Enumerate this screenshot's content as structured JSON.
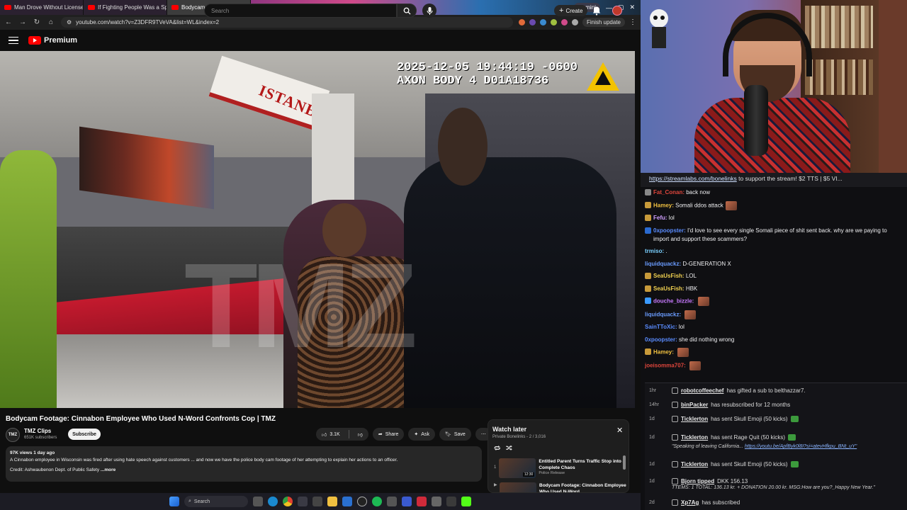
{
  "browser": {
    "tabs": [
      {
        "title": "Man Drove Without License Fo",
        "active": false
      },
      {
        "title": "If Fighting People Was a Sport",
        "active": false
      },
      {
        "title": "Bodycam Footage: Cinnab",
        "active": true
      }
    ],
    "gemini_label": "Gemini",
    "url": "youtube.com/watch?v=Z3DFR9TVeVA&list=WL&index=2",
    "finish_update": "Finish update"
  },
  "youtube": {
    "logo_text": "Premium",
    "search_placeholder": "Search",
    "create_label": "Create"
  },
  "video": {
    "timestamp_line1": "2025-12-05 19:44:19 -0600",
    "timestamp_line2": "AXON BODY 4 D01A18736",
    "sign_text": "ISTANBUL",
    "watermark": "TMZ",
    "title": "Bodycam Footage: Cinnabon Employee Who Used N-Word Confronts Cop | TMZ",
    "channel": {
      "name": "TMZ Clips",
      "subscribers": "651K subscribers",
      "avatar_text": "TMZ"
    },
    "subscribe_label": "Subscribe",
    "likes": "3.1K",
    "share_label": "Share",
    "ask_label": "Ask",
    "save_label": "Save",
    "description": {
      "meta": "97K views  1 day ago",
      "line1": "A Cinnabon employee in Wisconsin was fired after using hate speech against customers ... and now we have the police body cam footage of her attempting to explain her actions to an officer.",
      "credit": "Credit: Ashwaubenon Dept. of Public Safety",
      "more": "...more"
    }
  },
  "watch_later": {
    "title": "Watch later",
    "subtitle": "Private  Bonelinks - 2 / 3,016",
    "items": [
      {
        "index": "1",
        "title": "Entitled Parent Turns Traffic Stop into a Complete Chaos",
        "channel": "Police Release",
        "duration": "12:30"
      },
      {
        "index": "",
        "title": "Bodycam Footage: Cinnabon Employee Who Used N-Word",
        "channel": "",
        "duration": ""
      }
    ]
  },
  "taskbar": {
    "search_label": "Search"
  },
  "chat": {
    "banner_link": "https://streamlabs.com/bonelinks",
    "banner_text": "to support the stream! $2 TTS | $5 VI...",
    "messages": [
      {
        "user": "Fat_Conan:",
        "text": "back now",
        "color": "#e0463c",
        "badge": "#888888"
      },
      {
        "user": "Hamey:",
        "text": "Somali ddos attack",
        "color": "#f0c040",
        "badge": "#c89a3a",
        "emote": true
      },
      {
        "user": "Fefu:",
        "text": "lol",
        "color": "#d0a0ff",
        "badge": "#c89a3a"
      },
      {
        "user": "0xpoopster:",
        "text": "I'd love to see every single Somali piece of shit sent back. why are we paying to import and support these scammers?",
        "color": "#5a8cff",
        "badge": "#2a6ad0"
      },
      {
        "user": "trmiso:",
        "text": ".",
        "color": "#7ad0ff",
        "badge": ""
      },
      {
        "user": "liquidquackz:",
        "text": "D-GENERATION X",
        "color": "#6a9cff",
        "badge": ""
      },
      {
        "user": "SeaUsFish:",
        "text": "LOL",
        "color": "#f0d050",
        "badge": "#c89a3a"
      },
      {
        "user": "SeaUsFish:",
        "text": "HBK",
        "color": "#f0d050",
        "badge": "#c89a3a"
      },
      {
        "user": "douche_bizzle:",
        "text": "",
        "color": "#c87aff",
        "badge": "#3a9aff",
        "emote": true
      },
      {
        "user": "liquidquackz:",
        "text": "",
        "color": "#6a9cff",
        "badge": "",
        "emote": true
      },
      {
        "user": "SainTToXic:",
        "text": "lol",
        "color": "#5a8cff",
        "badge": ""
      },
      {
        "user": "0xpoopster:",
        "text": "she did nothing wrong",
        "color": "#5a8cff",
        "badge": ""
      },
      {
        "user": "Hamey:",
        "text": "",
        "color": "#f0c040",
        "badge": "#c89a3a",
        "emote": true
      },
      {
        "user": "joeisomma707:",
        "text": "",
        "color": "#e0463c",
        "badge": "",
        "emote": true
      }
    ],
    "events": [
      {
        "age": "1hr",
        "user": "robotcoffeechef",
        "text": "has gifted a sub to belthazzar7."
      },
      {
        "age": "14hr",
        "user": "binPacker",
        "text": "has resubscribed for 12 months"
      },
      {
        "age": "1d",
        "user": "Ticklerton",
        "text": "has sent Skull Emoji (50 kicks)"
      },
      {
        "age": "1d",
        "user": "Ticklerton",
        "text": "has sent Rage Quit (50 kicks)",
        "quote": "\"Speaking of leaving California...",
        "quote_link": "https://youtu.be/ApfByk0l8I?si=atevHfkpu_BNt_uY\""
      },
      {
        "age": "1d",
        "user": "Ticklerton",
        "text": "has sent Skull Emoji (50 kicks)"
      },
      {
        "age": "1d",
        "user": "Bjorn tipped",
        "text": "DKK 156.13",
        "quote": "TTEMS: 1 TOTAL: 136.13 kr. + DONATION 20.00 kr. MSG:How are you?_Happy New Year.\""
      },
      {
        "age": "2d",
        "user": "Xp7Ag",
        "text": "has subscribed"
      }
    ]
  }
}
